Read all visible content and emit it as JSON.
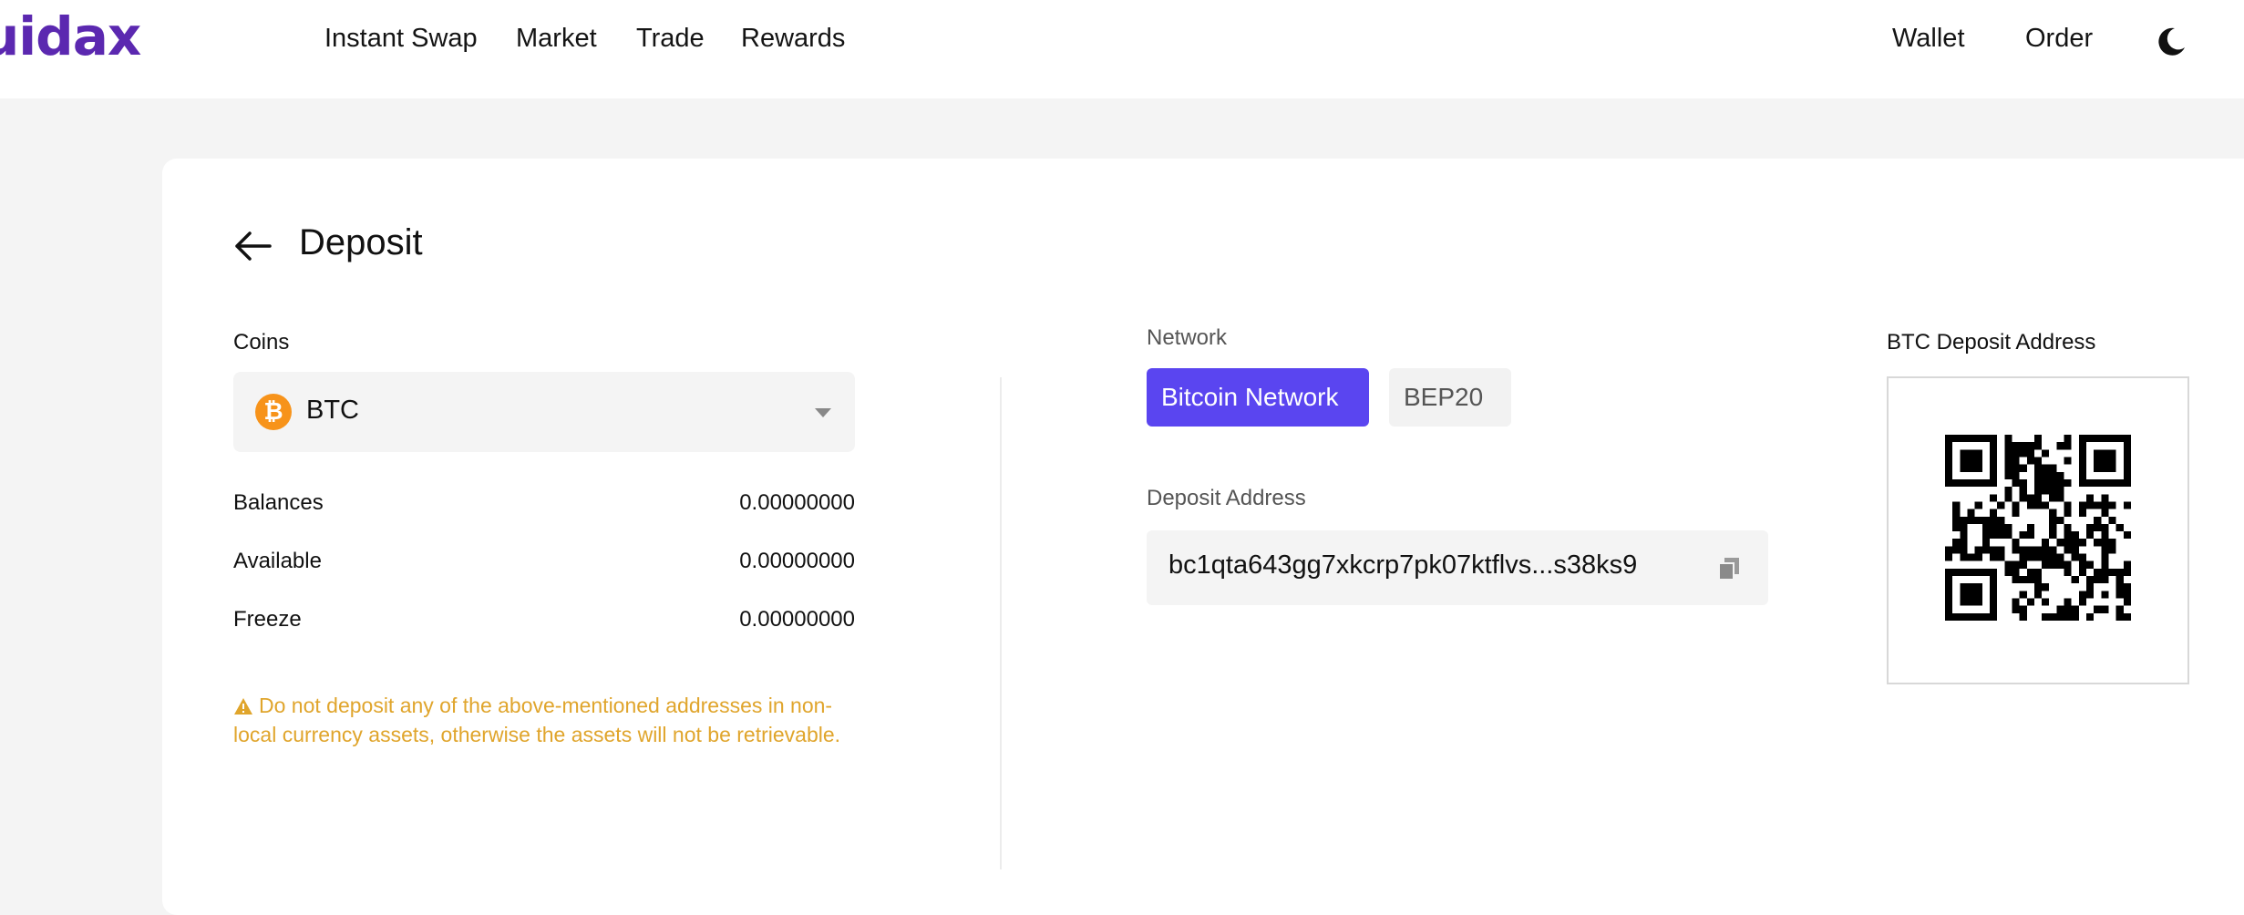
{
  "header": {
    "logo_text": "uidax",
    "nav": [
      {
        "label": "Instant Swap"
      },
      {
        "label": "Market"
      },
      {
        "label": "Trade"
      },
      {
        "label": "Rewards"
      }
    ],
    "right_nav": [
      {
        "label": "Wallet"
      },
      {
        "label": "Order"
      }
    ],
    "theme_icon": "moon-icon"
  },
  "page": {
    "title": "Deposit",
    "back_icon": "arrow-left-icon"
  },
  "coins": {
    "label": "Coins",
    "selected": "BTC",
    "coin_icon": "bitcoin-icon",
    "coin_glyph": "₿"
  },
  "balances": [
    {
      "label": "Balances",
      "value": "0.00000000"
    },
    {
      "label": "Available",
      "value": "0.00000000"
    },
    {
      "label": "Freeze",
      "value": "0.00000000"
    }
  ],
  "warning": {
    "icon": "warning-icon",
    "text": "Do not deposit any of the above-mentioned addresses in non-local currency assets, otherwise the assets will not be retrievable."
  },
  "network": {
    "label": "Network",
    "options": [
      {
        "label": "Bitcoin Network",
        "active": true
      },
      {
        "label": "BEP20",
        "active": false
      }
    ]
  },
  "deposit_address": {
    "label": "Deposit Address",
    "value": "bc1qta643gg7xkcrp7pk07ktflvs...s38ks9",
    "copy_icon": "copy-icon"
  },
  "qr": {
    "title": "BTC Deposit Address"
  },
  "colors": {
    "brand": "#5b28b0",
    "accent": "#5a45f0",
    "warning": "#e0a52c",
    "bitcoin": "#f7931a"
  }
}
